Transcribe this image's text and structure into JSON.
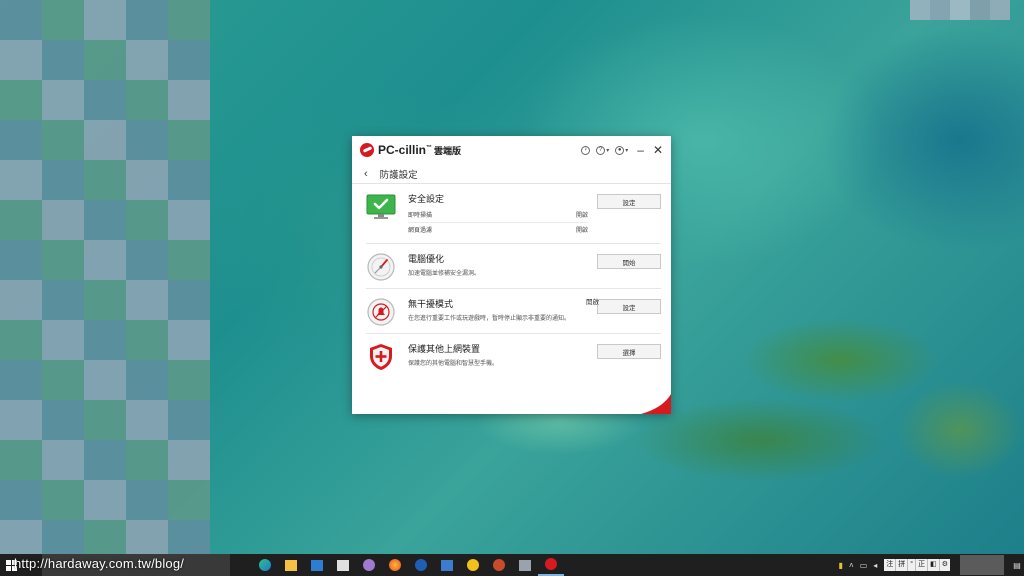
{
  "app": {
    "name": "PC-cillin",
    "trademark": "™",
    "edition": "雲端版",
    "brand_color": "#d71920"
  },
  "titlebar": {
    "icons": [
      "lightbulb-icon",
      "help-icon",
      "account-icon"
    ],
    "minimize": "–",
    "close": "✕"
  },
  "nav": {
    "back": "‹",
    "title": "防護設定"
  },
  "rows": [
    {
      "id": "security",
      "icon": "monitor-check-icon",
      "title": "安全設定",
      "lines": [
        {
          "label": "即時掃描",
          "status": "開啟"
        },
        {
          "label": "網頁過濾",
          "status": "開啟"
        }
      ],
      "button": "設定"
    },
    {
      "id": "optimize",
      "icon": "gauge-icon",
      "title": "電腦優化",
      "desc": "加速電腦並修補安全漏洞。",
      "button": "開始"
    },
    {
      "id": "dnd",
      "icon": "alarm-mute-icon",
      "title": "無干擾模式",
      "status": "開啟",
      "desc": "在您進行重要工作或玩遊戲時，暫時停止顯示非重要的通知。",
      "button": "設定"
    },
    {
      "id": "protect-devices",
      "icon": "shield-plus-icon",
      "title": "保護其他上網裝置",
      "desc": "保護您的其他電腦和智慧型手機。",
      "button": "選擇"
    }
  ],
  "taskbar": {
    "watermark": "http://hardaway.com.tw/blog/",
    "apps": [
      "edge-icon",
      "file-explorer-icon",
      "mail-icon",
      "store-icon",
      "cloud-icon",
      "firefox-icon",
      "ccleaner-icon",
      "virtualbox-icon",
      "norton-icon",
      "app-icon",
      "drive-icon",
      "pccillin-icon"
    ],
    "ime": [
      "注",
      "拼",
      "°",
      "正",
      "◧",
      "⚙"
    ]
  },
  "colors": {
    "taskbar": "#1f1f1f",
    "check_green": "#3db54a",
    "shield_red": "#d71920"
  }
}
